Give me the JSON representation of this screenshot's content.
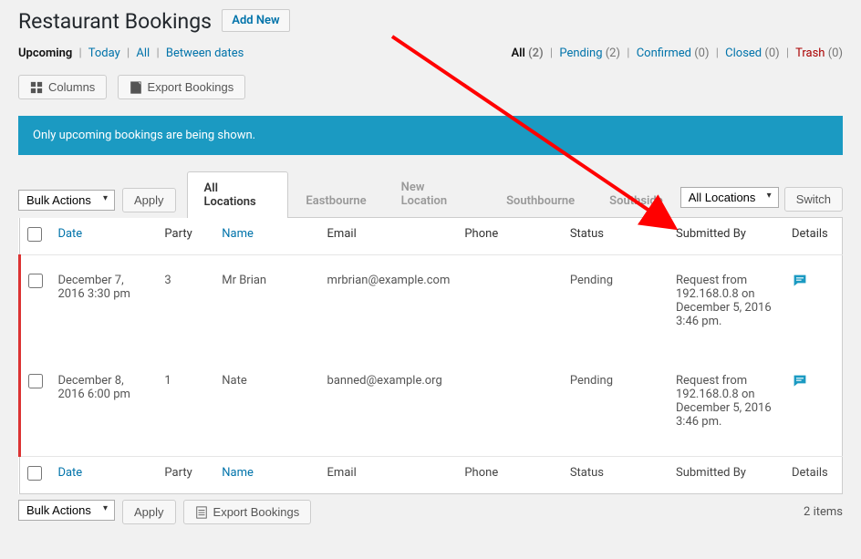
{
  "page": {
    "title": "Restaurant Bookings",
    "add_new": "Add New"
  },
  "view_filters": {
    "upcoming": "Upcoming",
    "today": "Today",
    "all": "All",
    "between": "Between dates"
  },
  "status_filters": {
    "all_label": "All",
    "all_count": "(2)",
    "pending_label": "Pending",
    "pending_count": "(2)",
    "confirmed_label": "Confirmed",
    "confirmed_count": "(0)",
    "closed_label": "Closed",
    "closed_count": "(0)",
    "trash_label": "Trash",
    "trash_count": "(0)"
  },
  "buttons": {
    "columns": "Columns",
    "export": "Export Bookings",
    "apply": "Apply",
    "switch": "Switch"
  },
  "notice": "Only upcoming bookings are being shown.",
  "bulk_actions": {
    "label": "Bulk Actions"
  },
  "location_select": "All Locations",
  "tabs": [
    {
      "label": "All Locations",
      "active": true
    },
    {
      "label": "Eastbourne",
      "active": false
    },
    {
      "label": "New Location",
      "active": false
    },
    {
      "label": "Southbourne",
      "active": false
    },
    {
      "label": "Southside",
      "active": false
    }
  ],
  "columns": {
    "date": "Date",
    "party": "Party",
    "name": "Name",
    "email": "Email",
    "phone": "Phone",
    "status": "Status",
    "submitted_by": "Submitted By",
    "details": "Details"
  },
  "rows": [
    {
      "date": "December 7, 2016 3:30 pm",
      "party": "3",
      "name": "Mr Brian",
      "email": "mrbrian@example.com",
      "phone": "",
      "status": "Pending",
      "submitted_by": "Request from 192.168.0.8 on December 5, 2016 3:46 pm."
    },
    {
      "date": "December 8, 2016 6:00 pm",
      "party": "1",
      "name": "Nate",
      "email": "banned@example.org",
      "phone": "",
      "status": "Pending",
      "submitted_by": "Request from 192.168.0.8 on December 5, 2016 3:46 pm."
    }
  ],
  "footer": {
    "items": "2 items"
  }
}
